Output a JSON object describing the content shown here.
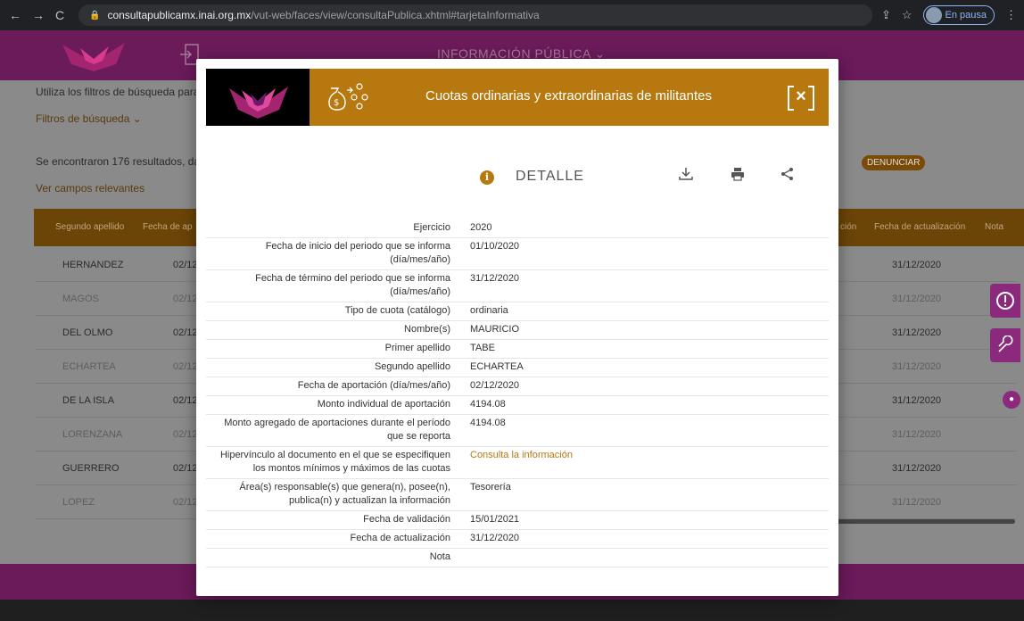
{
  "browser": {
    "url_domain": "consultapublicamx.inai.org.mx",
    "url_path": "/vut-web/faces/view/consultaPublica.xhtml#tarjetaInformativa",
    "profile_status": "En pausa"
  },
  "background": {
    "header_menu": "INFORMACIÓN PÚBLICA ⌄",
    "intro_text": "Utiliza los filtros de búsqueda para",
    "filters_label": "Filtros de búsqueda ⌄",
    "results_text": "Se encontraron 176 resultados, da",
    "relevant_fields_link": "Ver campos relevantes",
    "denunciar_button": "DENUNCIAR",
    "table_headers": {
      "segundo_apellido": "Segundo apellido",
      "fecha_aportacion": "Fecha de ap",
      "partial": "ción",
      "fecha_actualizacion": "Fecha de actualización",
      "nota": "Nota"
    },
    "rows": [
      {
        "apellido": "HERNANDEZ",
        "fecha": "02/12",
        "actualizacion": "31/12/2020",
        "light": false
      },
      {
        "apellido": "MAGOS",
        "fecha": "02/12",
        "actualizacion": "31/12/2020",
        "light": true
      },
      {
        "apellido": "DEL OLMO",
        "fecha": "02/12",
        "actualizacion": "31/12/2020",
        "light": false
      },
      {
        "apellido": "ECHARTEA",
        "fecha": "02/12",
        "actualizacion": "31/12/2020",
        "light": true
      },
      {
        "apellido": "DE LA ISLA",
        "fecha": "02/12",
        "actualizacion": "31/12/2020",
        "light": false
      },
      {
        "apellido": "LORENZANA",
        "fecha": "02/12",
        "actualizacion": "31/12/2020",
        "light": true
      },
      {
        "apellido": "GUERRERO",
        "fecha": "02/12",
        "actualizacion": "31/12/2020",
        "light": false
      },
      {
        "apellido": "LOPEZ",
        "fecha": "02/12",
        "actualizacion": "31/12/2020",
        "light": true
      }
    ]
  },
  "modal": {
    "title": "Cuotas ordinarias y extraordinarias de militantes",
    "close_label": "×",
    "detail_label": "DETALLE",
    "info_glyph": "i",
    "details": [
      {
        "label": "Ejercicio",
        "value": "2020"
      },
      {
        "label": "Fecha de inicio del periodo que se informa (día/mes/año)",
        "value": "01/10/2020"
      },
      {
        "label": "Fecha de término del periodo que se informa (día/mes/año)",
        "value": "31/12/2020"
      },
      {
        "label": "Tipo de cuota (catálogo)",
        "value": "ordinaria"
      },
      {
        "label": "Nombre(s)",
        "value": "MAURICIO"
      },
      {
        "label": "Primer apellido",
        "value": "TABE"
      },
      {
        "label": "Segundo apellido",
        "value": "ECHARTEA"
      },
      {
        "label": "Fecha de aportación (día/mes/año)",
        "value": "02/12/2020"
      },
      {
        "label": "Monto individual de aportación",
        "value": "4194.08"
      },
      {
        "label": "Monto agregado de aportaciones durante el período que se reporta",
        "value": "4194.08"
      },
      {
        "label": "Hipervínculo al documento en el que se especifiquen los montos mínimos y máximos de las cuotas",
        "value": "Consulta la información",
        "link": true
      },
      {
        "label": "Área(s) responsable(s) que genera(n), posee(n), publica(n) y actualizan la información",
        "value": "Tesorería"
      },
      {
        "label": "Fecha de validación",
        "value": "15/01/2021"
      },
      {
        "label": "Fecha de actualización",
        "value": "31/12/2020"
      },
      {
        "label": "Nota",
        "value": ""
      }
    ]
  },
  "colors": {
    "brand_magenta": "#6b1a5a",
    "accent_gold": "#b6780f"
  }
}
